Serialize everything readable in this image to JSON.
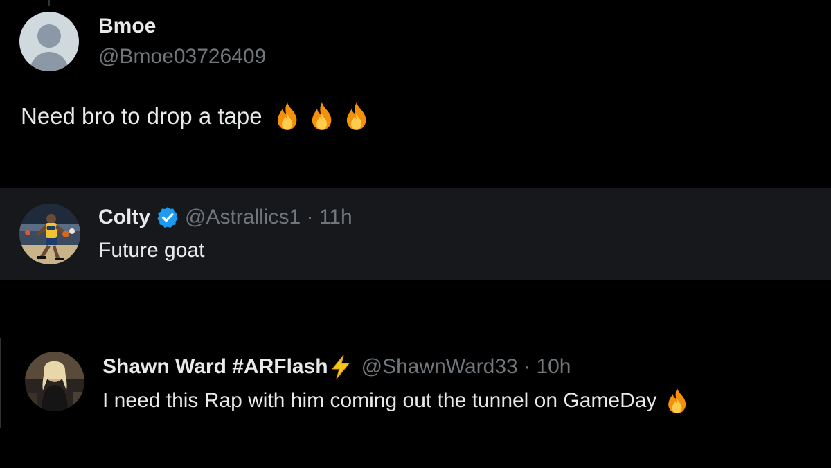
{
  "tweet": {
    "author_name": "Bmoe",
    "author_handle": "@Bmoe03726409",
    "text": "Need bro to drop a tape",
    "emojis": [
      "fire-emoji",
      "fire-emoji",
      "fire-emoji"
    ]
  },
  "replies": [
    {
      "author_name": "Colty",
      "verified": true,
      "handle": "@Astrallics1",
      "separator": " · ",
      "time": "11h",
      "text": "Future goat"
    },
    {
      "author_name": "Shawn Ward #ARFlash",
      "name_emoji": "lightning-bolt-emoji",
      "handle": "@ShawnWard33",
      "separator": " · ",
      "time": "10h",
      "text": "I need this Rap with him coming out the tunnel on GameDay",
      "emojis": [
        "fire-emoji"
      ]
    }
  ],
  "colors": {
    "background": "#000000",
    "card_background": "#16181c",
    "primary_text": "#e7e9ea",
    "secondary_text": "#71767b",
    "verified_blue": "#1d9bf0",
    "bolt_yellow": "#f5c518"
  }
}
